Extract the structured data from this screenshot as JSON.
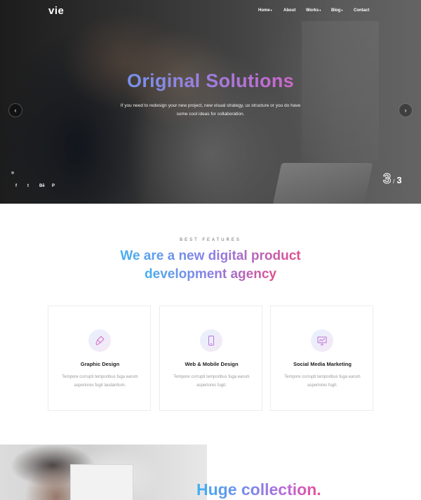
{
  "colors": {
    "gradient_start": "#4aa6f2",
    "gradient_mid": "#c56bd2",
    "gradient_end": "#f25a91",
    "card_border": "#ececec",
    "muted_text": "#9a9a9a"
  },
  "header": {
    "logo": "vie",
    "nav": [
      {
        "label": "Home",
        "has_dropdown": true
      },
      {
        "label": "About",
        "has_dropdown": false
      },
      {
        "label": "Works",
        "has_dropdown": true
      },
      {
        "label": "Blog",
        "has_dropdown": true
      },
      {
        "label": "Contact",
        "has_dropdown": false
      }
    ],
    "caret": "▾"
  },
  "hero": {
    "title": "Original Solutions",
    "subtitle": "If you need to redesign your new project, new visual strategy, ux structure or you do have some cool ideas for collaboration.",
    "prev_icon": "‹",
    "next_icon": "›",
    "slide_current": "3",
    "slide_separator": "/",
    "slide_total": "3",
    "social": [
      {
        "icon": "facebook-icon",
        "label": "f"
      },
      {
        "icon": "twitter-icon",
        "label": "t"
      },
      {
        "icon": "behance-icon",
        "label": "Bē"
      },
      {
        "icon": "pinterest-icon",
        "label": "P"
      }
    ]
  },
  "features": {
    "eyebrow": "BEST FEATURES",
    "headline_line1": "We are a new digital product",
    "headline_line2": "development agency",
    "cards": [
      {
        "icon": "paint-brush-icon",
        "title": "Graphic Design",
        "text": "Tempore corrupti temporibus fuga earum asperiores fugit laudantium."
      },
      {
        "icon": "mobile-phone-icon",
        "title": "Web & Mobile Design",
        "text": "Tempore corrupti temporibus fuga earum asperiores fugit."
      },
      {
        "icon": "presentation-icon",
        "title": "Social Media Marketing",
        "text": "Tempore corrupti temporibus fuga earum asperiores fugit."
      }
    ]
  },
  "collection": {
    "title": "Huge collection."
  }
}
